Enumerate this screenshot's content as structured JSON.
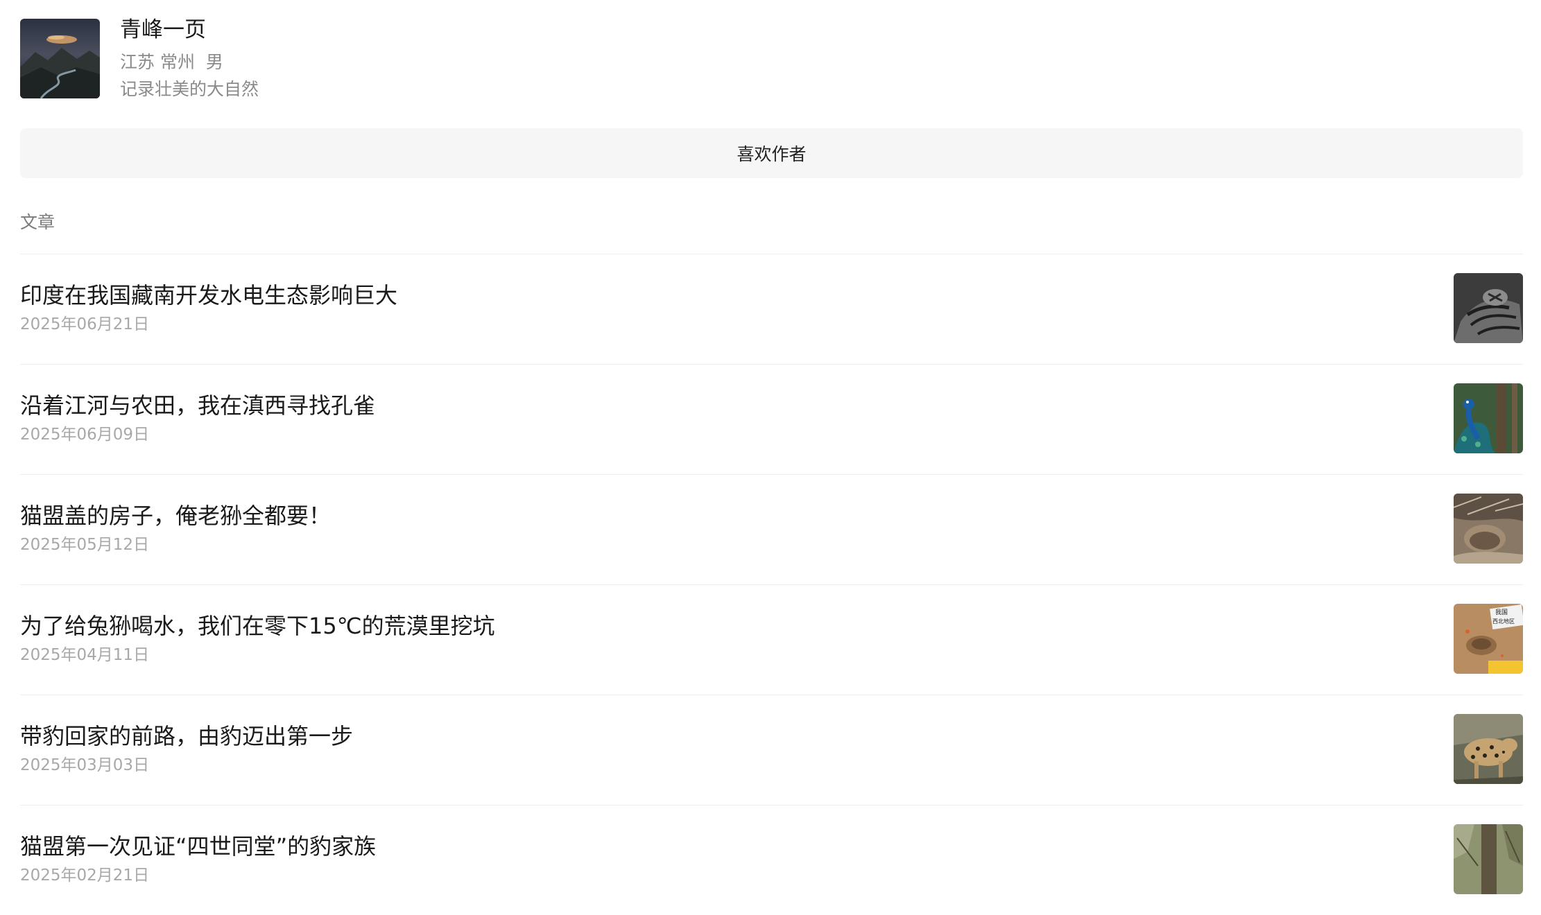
{
  "profile": {
    "name": "青峰一页",
    "meta": "江苏 常州  男",
    "bio": "记录壮美的大自然",
    "avatar_icon": "mountain-landscape-photo"
  },
  "like_button": {
    "label": "喜欢作者"
  },
  "section": {
    "label": "文章"
  },
  "articles": [
    {
      "title": "印度在我国藏南开发水电生态影响巨大",
      "date": "2025年06月21日",
      "thumb": "tiger-bw-photo"
    },
    {
      "title": "沿着江河与农田，我在滇西寻找孔雀",
      "date": "2025年06月09日",
      "thumb": "peacock-photo"
    },
    {
      "title": "猫盟盖的房子，俺老狲全都要！",
      "date": "2025年05月12日",
      "thumb": "den-burrow-photo"
    },
    {
      "title": "为了给兔狲喝水，我们在零下15℃的荒漠里挖坑",
      "date": "2025年04月11日",
      "thumb": "desert-dig-photo"
    },
    {
      "title": "带豹回家的前路，由豹迈出第一步",
      "date": "2025年03月03日",
      "thumb": "leopard-photo"
    },
    {
      "title": "猫盟第一次见证“四世同堂”的豹家族",
      "date": "2025年02月21日",
      "thumb": "forest-tree-photo"
    }
  ],
  "thumb_labels": {
    "desert_text_1": "我国",
    "desert_text_2": "西北地区"
  }
}
